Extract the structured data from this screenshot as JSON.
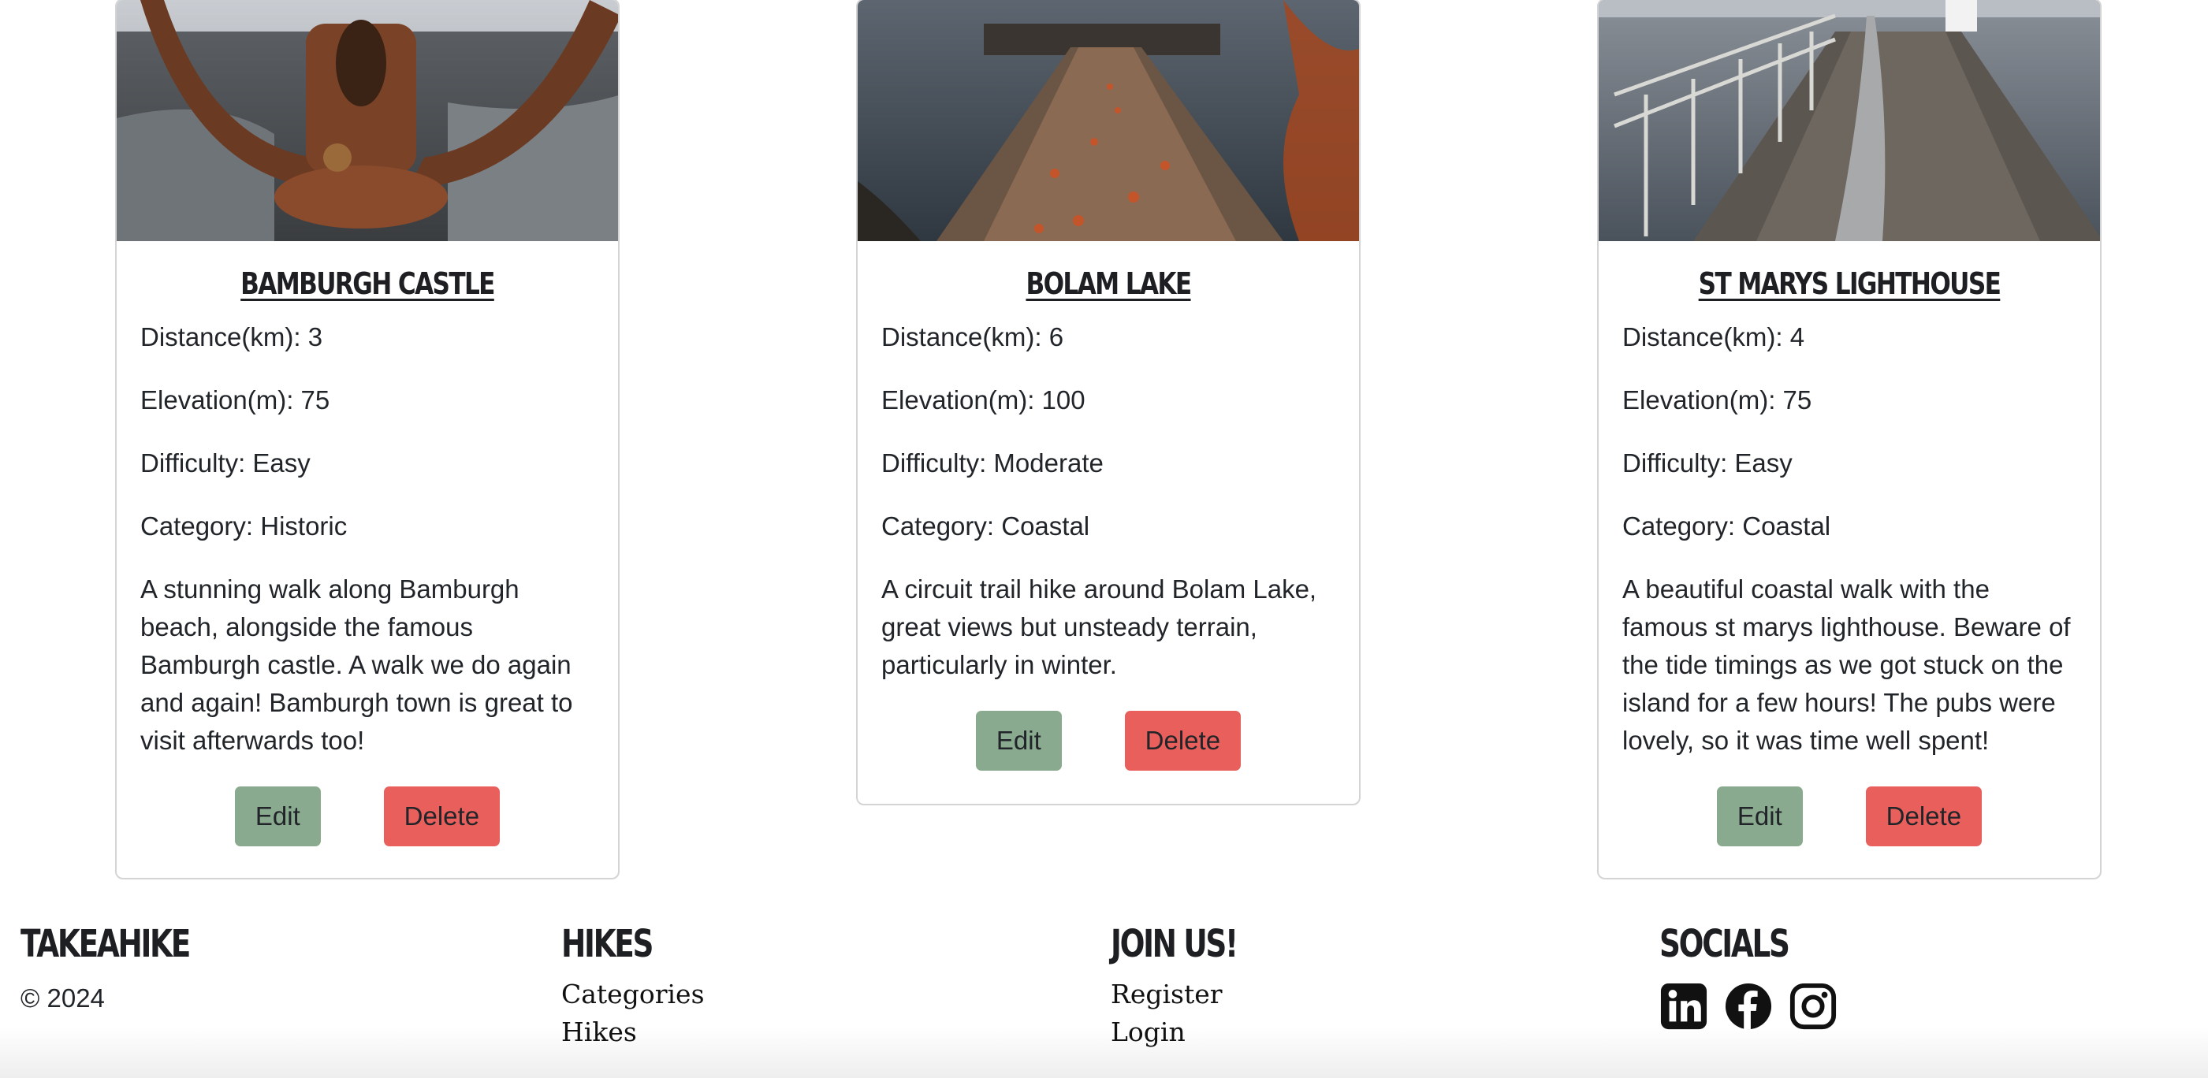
{
  "hikes": [
    {
      "title": "BAMBURGH CASTLE",
      "distance": "Distance(km): 3",
      "elevation": "Elevation(m): 75",
      "difficulty": "Difficulty: Easy",
      "category": "Category: Historic",
      "description": "A stunning walk along Bamburgh beach, alongside the famous Bamburgh castle. A walk we do again and again! Bamburgh town is great to visit afterwards too!",
      "edit_label": "Edit",
      "delete_label": "Delete"
    },
    {
      "title": "BOLAM LAKE",
      "distance": "Distance(km): 6",
      "elevation": "Elevation(m): 100",
      "difficulty": "Difficulty: Moderate",
      "category": "Category: Coastal",
      "description": "A circuit trail hike around Bolam Lake, great views but unsteady terrain, particularly in winter.",
      "edit_label": "Edit",
      "delete_label": "Delete"
    },
    {
      "title": "ST MARYS LIGHTHOUSE",
      "distance": "Distance(km): 4",
      "elevation": "Elevation(m): 75",
      "difficulty": "Difficulty: Easy",
      "category": "Category: Coastal",
      "description": "A beautiful coastal walk with the famous st marys lighthouse. Beware of the tide timings as we got stuck on the island for a few hours! The pubs were lovely, so it was time well spent!",
      "edit_label": "Edit",
      "delete_label": "Delete"
    }
  ],
  "footer": {
    "brand": {
      "heading": "TAKEAHIKE",
      "copyright": "© 2024"
    },
    "hikes": {
      "heading": "HIKES",
      "links": [
        "Categories",
        "Hikes"
      ]
    },
    "join": {
      "heading": "JOIN US!",
      "links": [
        "Register",
        "Login"
      ]
    },
    "socials": {
      "heading": "SOCIALS",
      "icons": [
        "linkedin-icon",
        "facebook-icon",
        "instagram-icon"
      ]
    }
  },
  "colors": {
    "edit_button": "#8aaa8f",
    "delete_button": "#e85f5c",
    "card_border": "#d4d4d4"
  }
}
